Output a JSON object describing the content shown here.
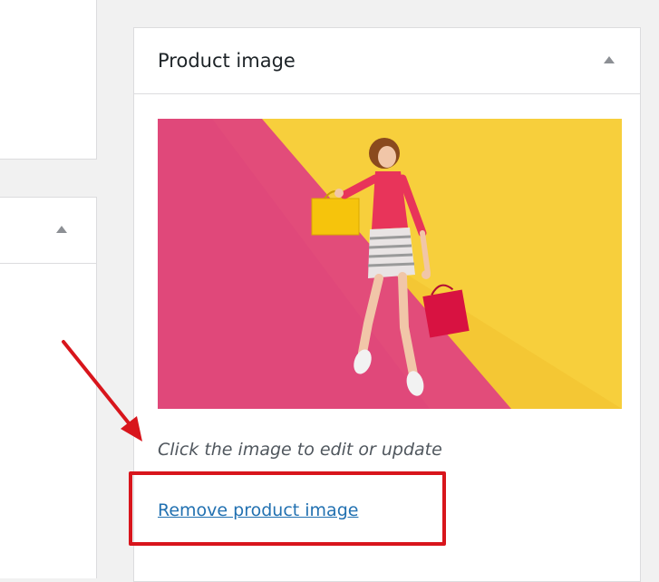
{
  "metabox": {
    "title": "Product image",
    "hint": "Click the image to edit or update",
    "remove_link": "Remove product image"
  },
  "image": {
    "subject": "woman jumping with shopping bags",
    "background_colors": [
      "#e24c7a",
      "#f4c734"
    ]
  },
  "icons": {
    "collapse": "triangle-up-icon"
  },
  "colors": {
    "link": "#2271b1",
    "annotation": "#d8151c",
    "border": "#dcdcde"
  }
}
